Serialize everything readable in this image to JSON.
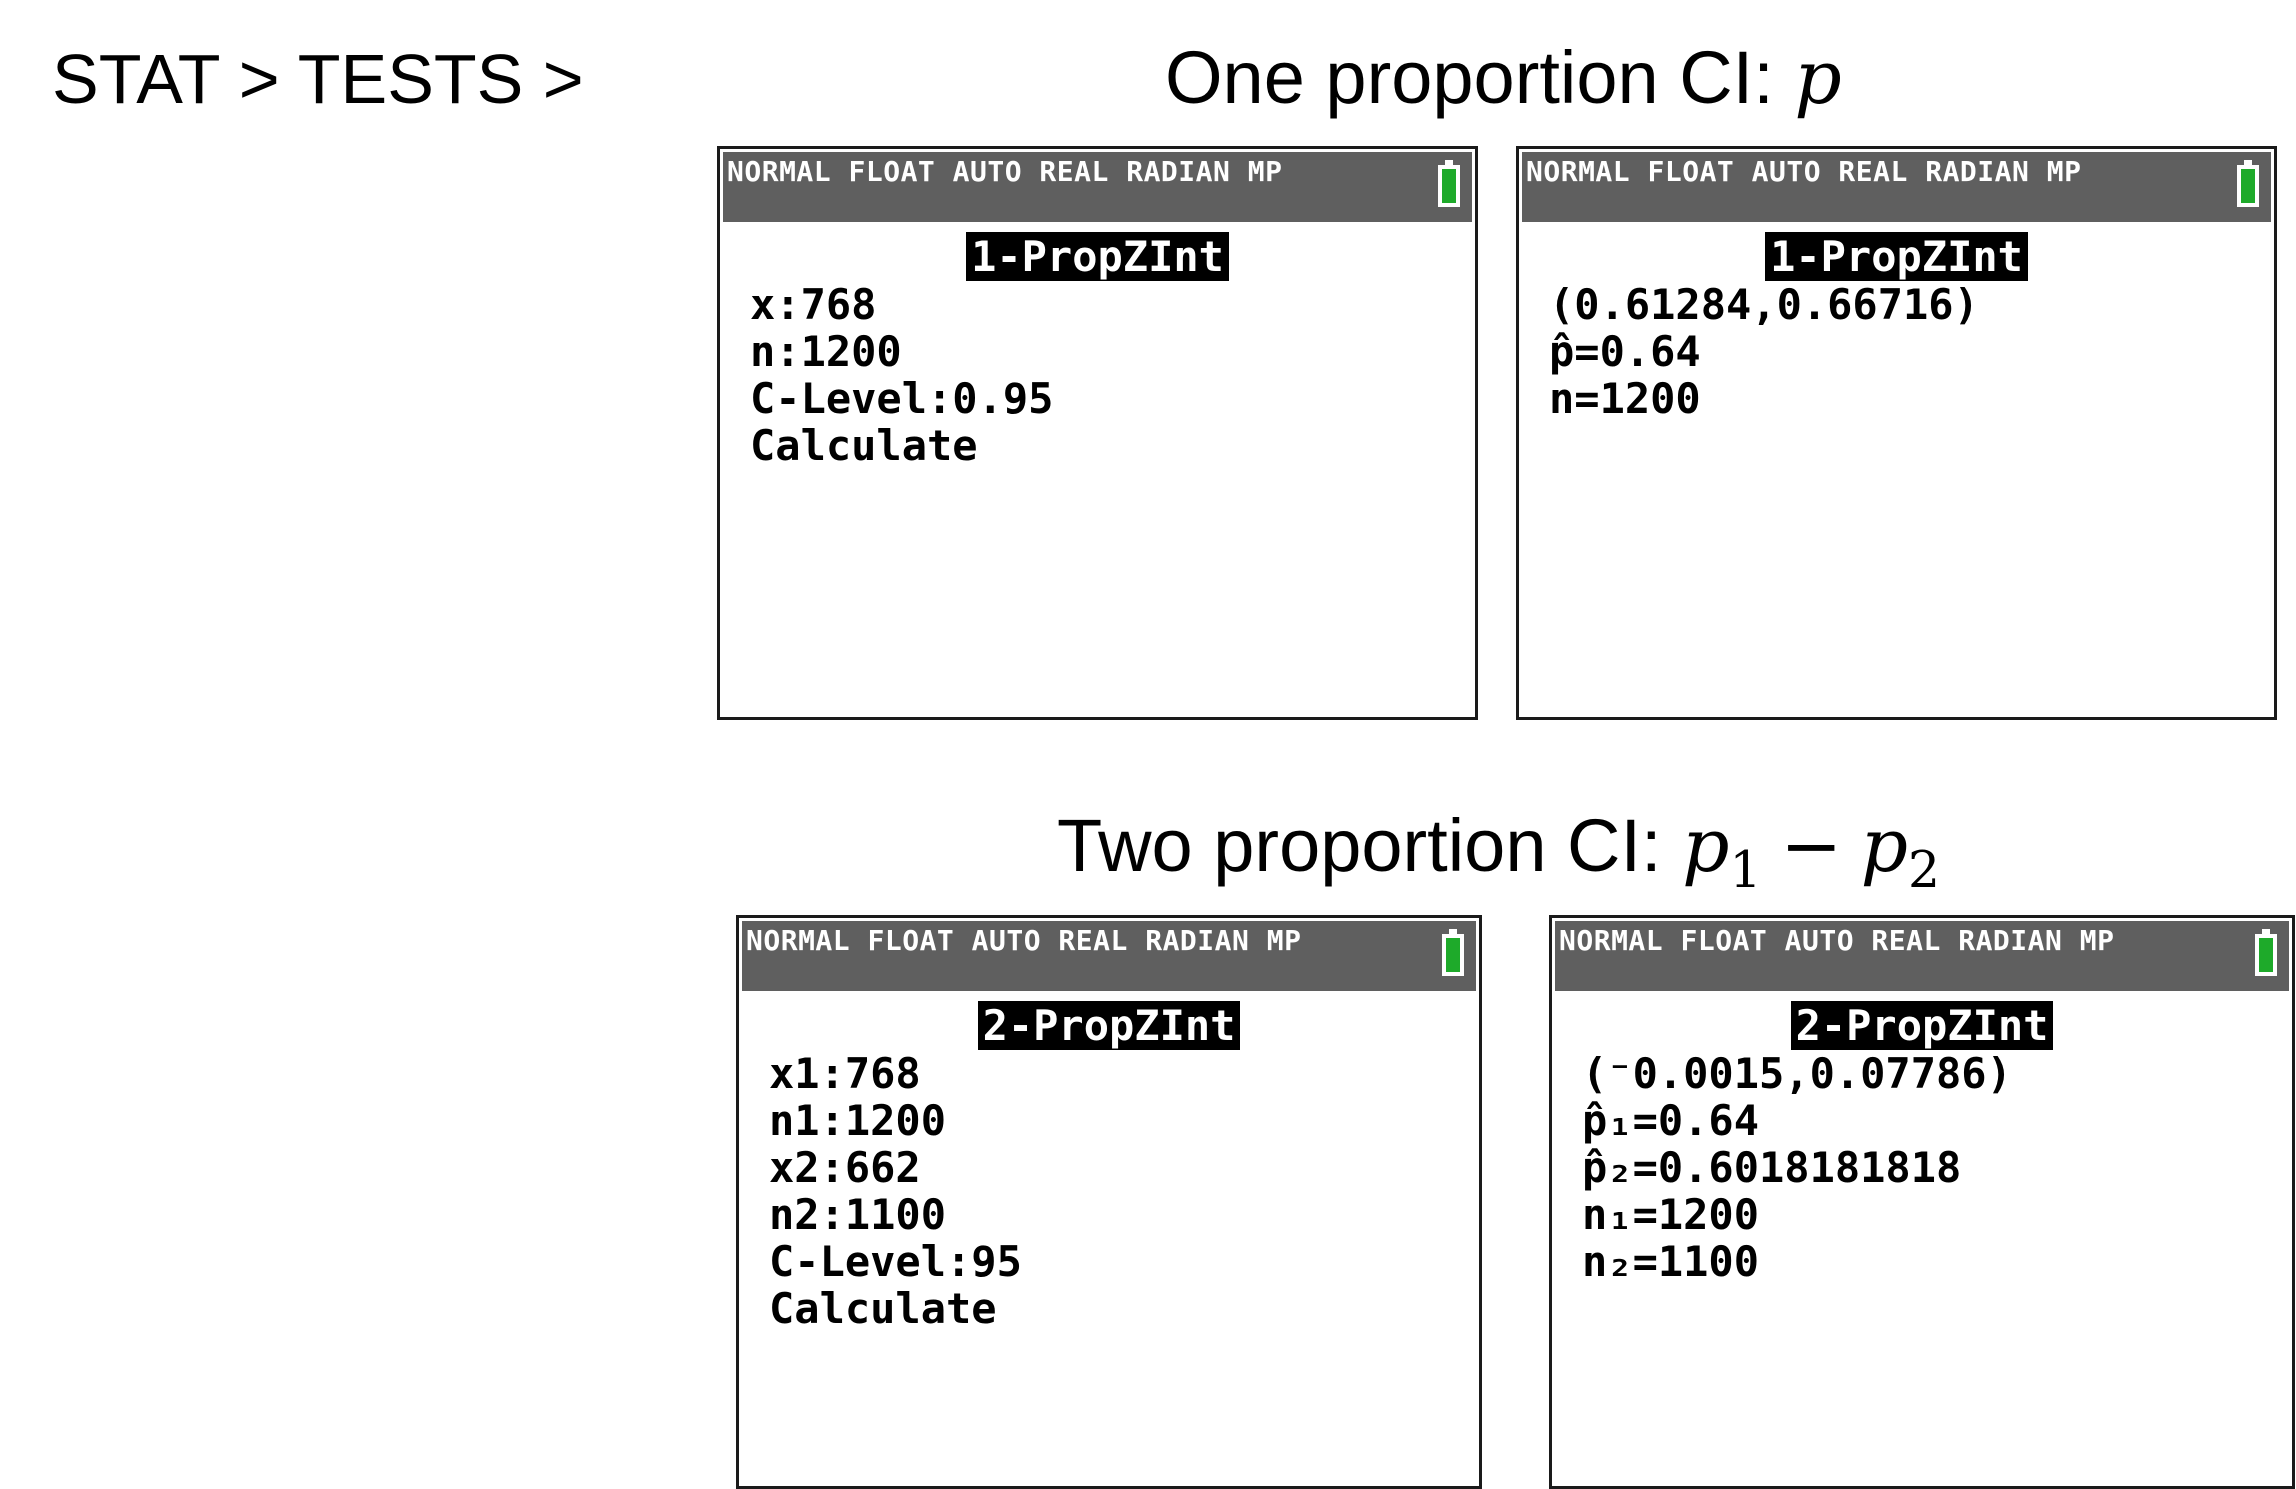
{
  "menu_path": "STAT > TESTS >",
  "sections": {
    "one_proportion": {
      "label": "One proportion CI: ",
      "parameter": "p"
    },
    "two_proportion": {
      "label": "Two proportion CI: ",
      "param_1": "p",
      "sub_1": "1",
      "operator": "−",
      "param_2": "p",
      "sub_2": "2"
    }
  },
  "status_bar": {
    "text": "NORMAL FLOAT AUTO REAL RADIAN MP",
    "battery_icon": "battery-icon",
    "battery_color": "#1eaa2a",
    "bar_color": "#5f5f5f"
  },
  "screens": {
    "one_input": {
      "heading": "1-PropZInt",
      "lines": [
        "x:768",
        "n:1200",
        "C-Level:0.95",
        "Calculate"
      ]
    },
    "one_output": {
      "heading": "1-PropZInt",
      "lines": [
        "(0.61284,0.66716)",
        "p̂=0.64",
        "n=1200"
      ]
    },
    "two_input": {
      "heading": "2-PropZInt",
      "lines": [
        "x1:768",
        "n1:1200",
        "x2:662",
        "n2:1100",
        "C-Level:95",
        "Calculate"
      ]
    },
    "two_output": {
      "heading": "2-PropZInt",
      "lines": [
        "(⁻0.0015,0.07786)",
        "p̂₁=0.64",
        "p̂₂=0.6018181818",
        "n₁=1200",
        "n₂=1100"
      ]
    }
  }
}
